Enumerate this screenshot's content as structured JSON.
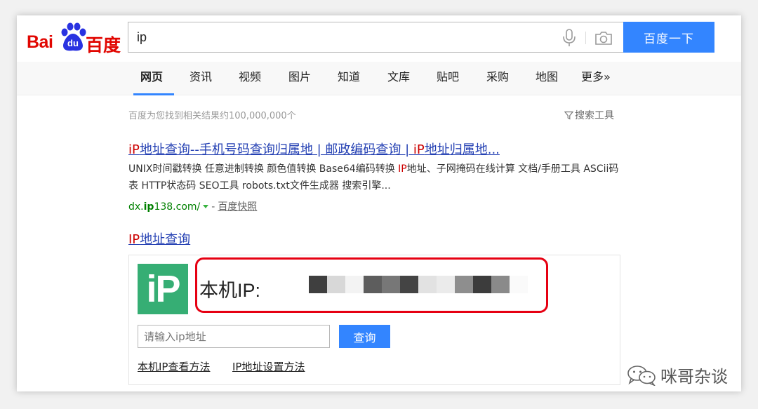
{
  "header": {
    "logo": {
      "latin": "Bai",
      "du": "du",
      "cn": "百度"
    },
    "search_value": "ip",
    "search_button": "百度一下",
    "icons": [
      "mic-icon",
      "camera-icon"
    ]
  },
  "nav": {
    "items": [
      {
        "label": "网页",
        "active": true
      },
      {
        "label": "资讯"
      },
      {
        "label": "视频"
      },
      {
        "label": "图片"
      },
      {
        "label": "知道"
      },
      {
        "label": "文库"
      },
      {
        "label": "贴吧"
      },
      {
        "label": "采购"
      },
      {
        "label": "地图"
      },
      {
        "label": "更多»"
      }
    ]
  },
  "toolbar": {
    "result_count": "百度为您找到相关结果约100,000,000个",
    "search_tools": "搜索工具"
  },
  "result1": {
    "title_hl1": "iP",
    "title_part1": "地址查询--手机号码查询归属地 | 邮政编码查询 | ",
    "title_hl2": "iP",
    "title_part2": "地址归属地...",
    "abs_part1": "UNIX时间戳转换 任意进制转换 颜色值转换 Base64编码转换 ",
    "abs_hl": "IP",
    "abs_part2": "地址、子网掩码在线计算 文档/手册工具 ASCii码表 HTTP状态码 SEO工具 robots.txt文件生成器 搜索引擎...",
    "url_prefix": "dx.",
    "url_bold": "ip",
    "url_suffix": "138.com/",
    "url_dash": "-",
    "snapshot": "百度快照"
  },
  "result2": {
    "title_hl": "IP",
    "title_rest": "地址查询",
    "logo_text": "iP",
    "ip_label": "本机IP:",
    "input_placeholder": "请输入ip地址",
    "query_button": "查询",
    "link1": "本机IP查看方法",
    "link2": "IP地址设置方法"
  },
  "watermark": {
    "text": "咪哥杂谈"
  },
  "colors": {
    "brand_red": "#e10601",
    "button_blue": "#3385ff",
    "link_blue": "#2440b3",
    "highlight_red": "#c00",
    "url_green": "#008000",
    "ip_logo_green": "#36ae74",
    "annotation_red": "#e60012"
  }
}
